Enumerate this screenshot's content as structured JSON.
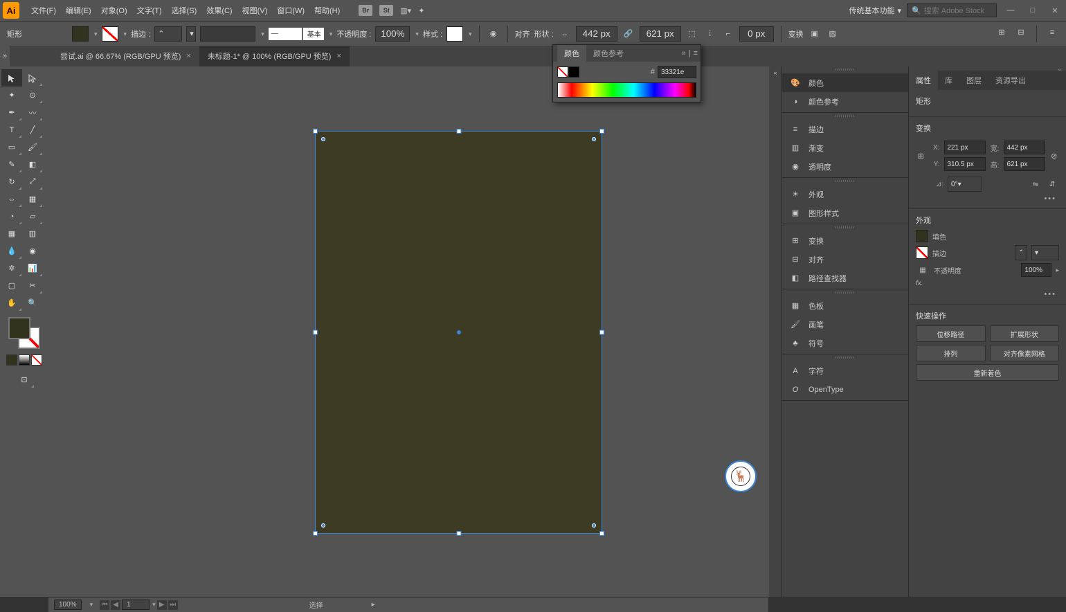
{
  "app": {
    "logo": "Ai"
  },
  "menu": {
    "items": [
      "文件(F)",
      "编辑(E)",
      "对象(O)",
      "文字(T)",
      "选择(S)",
      "效果(C)",
      "视图(V)",
      "窗口(W)",
      "帮助(H)"
    ],
    "bridge": "Br",
    "stock": "St"
  },
  "header_right": {
    "workspace": "传统基本功能",
    "search_placeholder": "搜索 Adobe Stock"
  },
  "control": {
    "shape_label": "矩形",
    "stroke_label": "描边 :",
    "profile_label": "基本",
    "opacity_label": "不透明度 :",
    "opacity_value": "100%",
    "style_label": "样式 :",
    "align_label": "对齐",
    "shape_btn": "形状 :",
    "width_value": "442 px",
    "height_value": "621 px",
    "corner_value": "0 px",
    "transform_label": "变换"
  },
  "tabs": [
    {
      "label": "尝试.ai @ 66.67% (RGB/GPU 预览)",
      "active": false
    },
    {
      "label": "未标题-1* @ 100% (RGB/GPU 预览)",
      "active": true
    }
  ],
  "color_panel": {
    "tab1": "颜色",
    "tab2": "颜色参考",
    "hex_prefix": "#",
    "hex_value": "33321e"
  },
  "panel_list": {
    "g1": [
      "颜色",
      "颜色参考"
    ],
    "g2": [
      "描边",
      "渐变",
      "透明度"
    ],
    "g3": [
      "外观",
      "图形样式"
    ],
    "g4": [
      "变换",
      "对齐",
      "路径查找器"
    ],
    "g5": [
      "色板",
      "画笔",
      "符号"
    ],
    "g6": [
      "字符",
      "OpenType"
    ]
  },
  "props": {
    "tabs": [
      "属性",
      "库",
      "图层",
      "资源导出"
    ],
    "shape_type": "矩形",
    "transform_heading": "变换",
    "x_label": "X:",
    "x_value": "221 px",
    "y_label": "Y:",
    "y_value": "310.5 px",
    "w_label": "宽:",
    "w_value": "442 px",
    "h_label": "高:",
    "h_value": "621 px",
    "angle_label": "⊿:",
    "angle_value": "0°",
    "appearance_heading": "外观",
    "fill_label": "填色",
    "stroke_label": "描边",
    "opacity_label": "不透明度",
    "opacity_value": "100%",
    "fx_label": "fx.",
    "quick_heading": "快速操作",
    "btn1": "位移路径",
    "btn2": "扩展形状",
    "btn3": "排列",
    "btn4": "对齐像素网格",
    "btn5": "重新着色"
  },
  "status": {
    "zoom": "100%",
    "page": "1",
    "mode": "选择"
  }
}
